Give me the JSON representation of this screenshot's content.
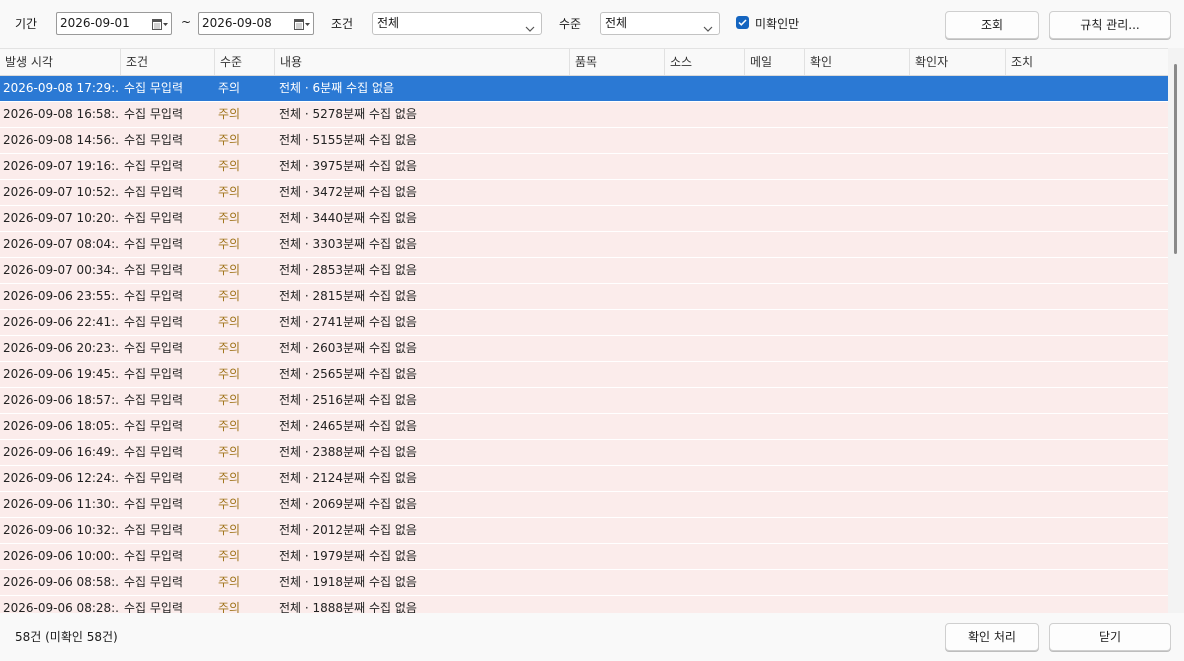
{
  "filters": {
    "period_label": "기간",
    "date_from": "2026-09-01",
    "range_sep": "~",
    "date_to": "2026-09-08",
    "condition_label": "조건",
    "condition_value": "전체",
    "level_label": "수준",
    "level_value": "전체",
    "unconfirmed_label": "미확인만",
    "unconfirmed_checked": true,
    "search_button": "조회",
    "rules_button": "규칙 관리..."
  },
  "columns": [
    "발생 시각",
    "조건",
    "수준",
    "내용",
    "품목",
    "소스",
    "메일",
    "확인",
    "확인자",
    "조치"
  ],
  "rows": [
    {
      "time": "2026-09-08 17:29:...",
      "cond": "수집 무입력",
      "level": "주의",
      "content": "전체 · 6분째 수집 없음"
    },
    {
      "time": "2026-09-08 16:58:...",
      "cond": "수집 무입력",
      "level": "주의",
      "content": "전체 · 5278분째 수집 없음"
    },
    {
      "time": "2026-09-08 14:56:...",
      "cond": "수집 무입력",
      "level": "주의",
      "content": "전체 · 5155분째 수집 없음"
    },
    {
      "time": "2026-09-07 19:16:...",
      "cond": "수집 무입력",
      "level": "주의",
      "content": "전체 · 3975분째 수집 없음"
    },
    {
      "time": "2026-09-07 10:52:...",
      "cond": "수집 무입력",
      "level": "주의",
      "content": "전체 · 3472분째 수집 없음"
    },
    {
      "time": "2026-09-07 10:20:...",
      "cond": "수집 무입력",
      "level": "주의",
      "content": "전체 · 3440분째 수집 없음"
    },
    {
      "time": "2026-09-07 08:04:...",
      "cond": "수집 무입력",
      "level": "주의",
      "content": "전체 · 3303분째 수집 없음"
    },
    {
      "time": "2026-09-07 00:34:...",
      "cond": "수집 무입력",
      "level": "주의",
      "content": "전체 · 2853분째 수집 없음"
    },
    {
      "time": "2026-09-06 23:55:...",
      "cond": "수집 무입력",
      "level": "주의",
      "content": "전체 · 2815분째 수집 없음"
    },
    {
      "time": "2026-09-06 22:41:...",
      "cond": "수집 무입력",
      "level": "주의",
      "content": "전체 · 2741분째 수집 없음"
    },
    {
      "time": "2026-09-06 20:23:...",
      "cond": "수집 무입력",
      "level": "주의",
      "content": "전체 · 2603분째 수집 없음"
    },
    {
      "time": "2026-09-06 19:45:...",
      "cond": "수집 무입력",
      "level": "주의",
      "content": "전체 · 2565분째 수집 없음"
    },
    {
      "time": "2026-09-06 18:57:...",
      "cond": "수집 무입력",
      "level": "주의",
      "content": "전체 · 2516분째 수집 없음"
    },
    {
      "time": "2026-09-06 18:05:...",
      "cond": "수집 무입력",
      "level": "주의",
      "content": "전체 · 2465분째 수집 없음"
    },
    {
      "time": "2026-09-06 16:49:...",
      "cond": "수집 무입력",
      "level": "주의",
      "content": "전체 · 2388분째 수집 없음"
    },
    {
      "time": "2026-09-06 12:24:...",
      "cond": "수집 무입력",
      "level": "주의",
      "content": "전체 · 2124분째 수집 없음"
    },
    {
      "time": "2026-09-06 11:30:...",
      "cond": "수집 무입력",
      "level": "주의",
      "content": "전체 · 2069분째 수집 없음"
    },
    {
      "time": "2026-09-06 10:32:...",
      "cond": "수집 무입력",
      "level": "주의",
      "content": "전체 · 2012분째 수집 없음"
    },
    {
      "time": "2026-09-06 10:00:...",
      "cond": "수집 무입력",
      "level": "주의",
      "content": "전체 · 1979분째 수집 없음"
    },
    {
      "time": "2026-09-06 08:58:...",
      "cond": "수집 무입력",
      "level": "주의",
      "content": "전체 · 1918분째 수집 없음"
    },
    {
      "time": "2026-09-06 08:28:...",
      "cond": "수집 무입력",
      "level": "주의",
      "content": "전체 · 1888분째 수집 없음"
    }
  ],
  "selected_row": 0,
  "footer": {
    "summary": "58건 (미확인 58건)",
    "confirm_button": "확인 처리",
    "close_button": "닫기"
  },
  "colors": {
    "selected_row": "#2b79d4",
    "unconfirmed_row": "#fbeceb",
    "level_warning": "#a0741a",
    "checkbox_accent": "#1565c0"
  }
}
